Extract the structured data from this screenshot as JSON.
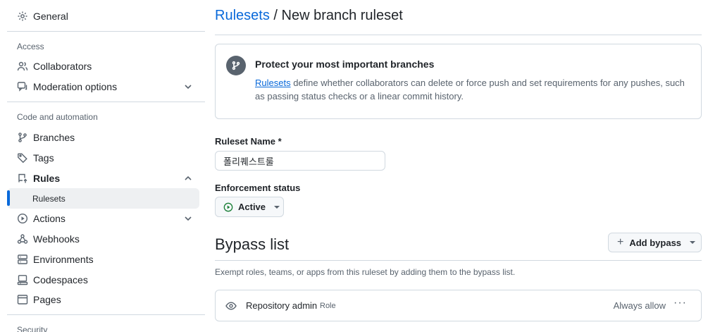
{
  "sidebar": {
    "general": "General",
    "access_heading": "Access",
    "collaborators": "Collaborators",
    "moderation": "Moderation options",
    "code_heading": "Code and automation",
    "branches": "Branches",
    "tags": "Tags",
    "rules": "Rules",
    "rulesets": "Rulesets",
    "actions": "Actions",
    "webhooks": "Webhooks",
    "environments": "Environments",
    "codespaces": "Codespaces",
    "pages": "Pages",
    "security_heading": "Security"
  },
  "breadcrumb": {
    "parent": "Rulesets",
    "separator": "/",
    "current": "New branch ruleset"
  },
  "info": {
    "title": "Protect your most important branches",
    "link": "Rulesets",
    "text": " define whether collaborators can delete or force push and set requirements for any pushes, such as passing status checks or a linear commit history."
  },
  "form": {
    "name_label": "Ruleset Name *",
    "name_value": "폴리퀘스트룰",
    "enforcement_label": "Enforcement status",
    "enforcement_value": "Active"
  },
  "bypass": {
    "title": "Bypass list",
    "add_button": "Add bypass",
    "description": "Exempt roles, teams, or apps from this ruleset by adding them to the bypass list.",
    "entry_name": "Repository admin",
    "entry_type": "Role",
    "entry_mode": "Always allow",
    "more": "···"
  },
  "colors": {
    "accent": "#0969da",
    "active_green": "#1a7f37",
    "muted": "#59636e",
    "border": "#d1d9e0"
  }
}
